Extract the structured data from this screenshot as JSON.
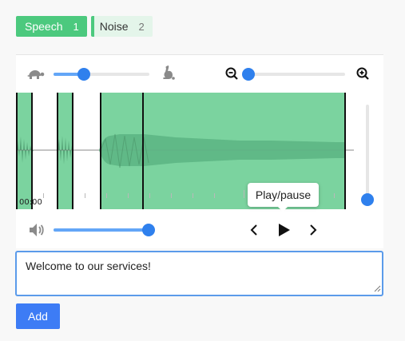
{
  "labels": [
    {
      "name": "Speech",
      "count": "1",
      "selected": true,
      "color": "#4cc97e"
    },
    {
      "name": "Noise",
      "count": "2",
      "selected": false,
      "color": "#4cc97e"
    }
  ],
  "controls": {
    "speed_slider_value": 0.3,
    "zoom_slider_value": 0.05,
    "volume_slider_value": 0.93,
    "vertical_zoom_value": 0.05
  },
  "waveform": {
    "time_label": "00:00",
    "segment_color": "#7bd39f"
  },
  "tooltip": {
    "text": "Play/pause"
  },
  "transcript": {
    "value": "Welcome to our services!"
  },
  "add_button": {
    "label": "Add",
    "color": "#3d7cf5"
  },
  "icons": {
    "speed_slow": "turtle-icon",
    "speed_fast": "rabbit-icon",
    "zoom_out": "zoom-out-icon",
    "zoom_in": "zoom-in-icon",
    "volume": "volume-icon",
    "prev": "chevron-left-icon",
    "play": "play-icon",
    "next": "chevron-right-icon"
  }
}
